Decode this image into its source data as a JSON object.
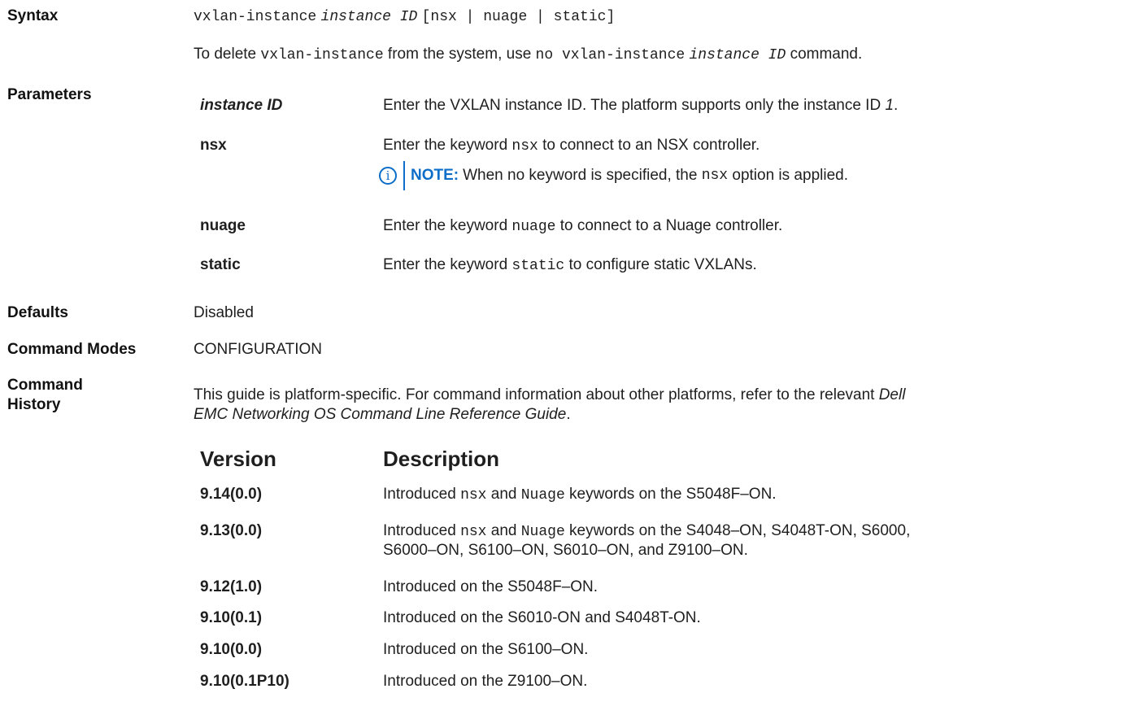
{
  "syntax": {
    "label": "Syntax",
    "cmd": "vxlan-instance",
    "arg": "instance ID",
    "opts": "[nsx | nuage | static]",
    "delete_prefix": "To delete",
    "delete_cmd": "vxlan-instance",
    "delete_mid": "from the system, use",
    "delete_no": "no vxlan-instance",
    "delete_arg": "instance ID",
    "delete_suffix": "command."
  },
  "parameters": {
    "label": "Parameters",
    "items": [
      {
        "term": "instance ID",
        "desc_pre": "Enter the VXLAN instance ID. The platform supports only the instance ID",
        "desc_em": "1",
        "desc_post": "."
      },
      {
        "term": "nsx",
        "desc_pre": "Enter the keyword",
        "code": "nsx",
        "desc_post": "to connect to an NSX controller."
      },
      {
        "term": "nuage",
        "desc_pre": "Enter the keyword",
        "code": "nuage",
        "desc_post": "to connect to a Nuage controller."
      },
      {
        "term": "static",
        "desc_pre": "Enter the keyword",
        "code": "static",
        "desc_post": "to configure static VXLANs."
      }
    ],
    "note": {
      "icon": "info-icon",
      "label": "NOTE:",
      "pre": "When no keyword is specified, the",
      "code": "nsx",
      "post": "option is applied."
    }
  },
  "defaults": {
    "label": "Defaults",
    "value": "Disabled"
  },
  "command_modes": {
    "label": "Command Modes",
    "value": "CONFIGURATION"
  },
  "command_history": {
    "label_line1": "Command",
    "label_line2": "History",
    "intro_pre": "This guide is platform-specific. For command information about other platforms, refer to the relevant",
    "intro_em1": "Dell",
    "intro_em2": "EMC Networking OS Command Line Reference Guide",
    "intro_post": ".",
    "col_version": "Version",
    "col_description": "Description",
    "rows": [
      {
        "version": "9.14(0.0)",
        "pre": "Introduced",
        "code1": "nsx",
        "mid": "and",
        "code2": "Nuage",
        "post": "keywords on the S5048F–ON."
      },
      {
        "version": "9.13(0.0)",
        "pre": "Introduced",
        "code1": "nsx",
        "mid": "and",
        "code2": "Nuage",
        "post": "keywords on the S4048–ON, S4048T-ON, S6000,",
        "line2": "S6000–ON, S6100–ON, S6010–ON, and Z9100–ON."
      },
      {
        "version": "9.12(1.0)",
        "text": "Introduced on the S5048F–ON."
      },
      {
        "version": "9.10(0.1)",
        "text": "Introduced on the S6010-ON and S4048T-ON."
      },
      {
        "version": "9.10(0.0)",
        "text": "Introduced on the S6100–ON."
      },
      {
        "version": "9.10(0.1P10)",
        "text": "Introduced on the Z9100–ON."
      }
    ]
  }
}
